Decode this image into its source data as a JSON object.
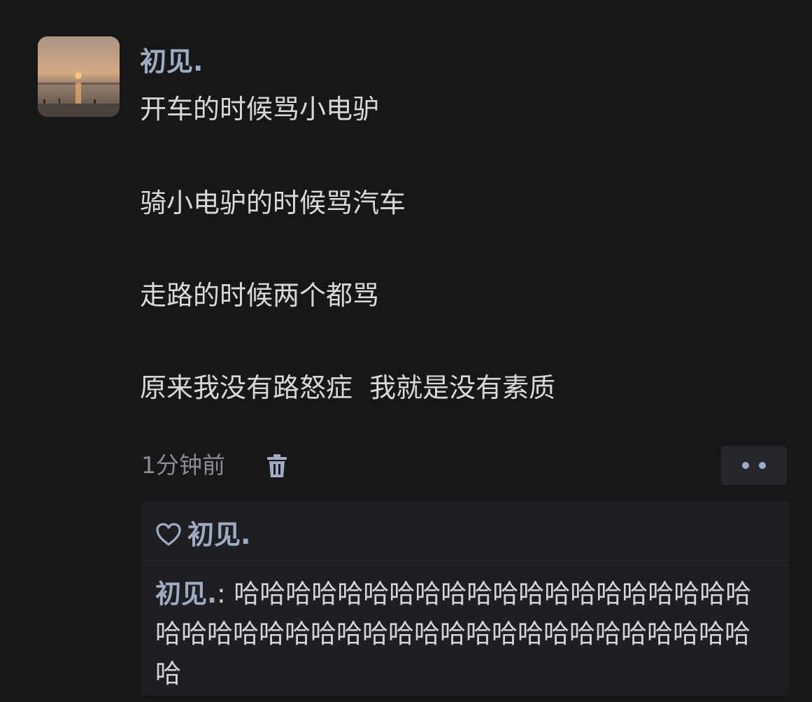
{
  "post": {
    "username": "初见.",
    "lines": [
      "开车的时候骂小电驴",
      "骑小电驴的时候骂汽车",
      "走路的时候两个都骂",
      "原来我没有路怒症  我就是没有素质"
    ],
    "timestamp": "1分钟前"
  },
  "likes": {
    "name": "初见."
  },
  "comment": {
    "author": "初见.",
    "separator": ": ",
    "text": "哈哈哈哈哈哈哈哈哈哈哈哈哈哈哈哈哈哈哈哈哈哈哈哈哈哈哈哈哈哈哈哈哈哈哈哈哈哈哈哈哈哈哈哈"
  },
  "icons": {
    "avatar": "sunset-photo",
    "delete": "trash-icon",
    "more": "more-dots-icon",
    "like": "heart-icon"
  },
  "colors": {
    "background": "#171719",
    "name": "#9eabc1",
    "text": "#d8d8da",
    "muted": "#8b8b90",
    "panel": "#1f1f23"
  }
}
